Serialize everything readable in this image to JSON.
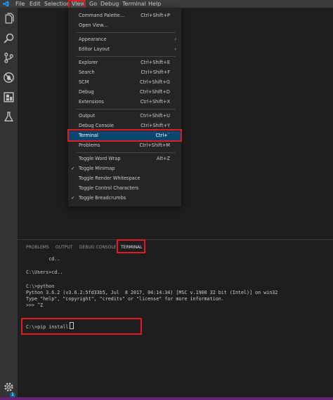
{
  "menubar": {
    "items": [
      "File",
      "Edit",
      "Selection",
      "View",
      "Go",
      "Debug",
      "Terminal",
      "Help"
    ]
  },
  "view_menu": {
    "items": [
      {
        "label": "Command Palette...",
        "shortcut": "Ctrl+Shift+P"
      },
      {
        "label": "Open View...",
        "shortcut": ""
      },
      {
        "label": "Appearance",
        "shortcut": "",
        "submenu": true
      },
      {
        "label": "Editor Layout",
        "shortcut": "",
        "submenu": true
      },
      {
        "label": "Explorer",
        "shortcut": "Ctrl+Shift+E"
      },
      {
        "label": "Search",
        "shortcut": "Ctrl+Shift+F"
      },
      {
        "label": "SCM",
        "shortcut": "Ctrl+Shift+G"
      },
      {
        "label": "Debug",
        "shortcut": "Ctrl+Shift+D"
      },
      {
        "label": "Extensions",
        "shortcut": "Ctrl+Shift+X"
      },
      {
        "label": "Output",
        "shortcut": "Ctrl+Shift+U"
      },
      {
        "label": "Debug Console",
        "shortcut": "Ctrl+Shift+Y"
      },
      {
        "label": "Terminal",
        "shortcut": "Ctrl+`",
        "selected": true
      },
      {
        "label": "Problems",
        "shortcut": "Ctrl+Shift+M"
      },
      {
        "label": "Toggle Word Wrap",
        "shortcut": "Alt+Z"
      },
      {
        "label": "Toggle Minimap",
        "shortcut": "",
        "checked": true
      },
      {
        "label": "Toggle Render Whitespace",
        "shortcut": ""
      },
      {
        "label": "Toggle Control Characters",
        "shortcut": ""
      },
      {
        "label": "Toggle Breadcrumbs",
        "shortcut": "",
        "checked": true
      }
    ],
    "check_glyph": "✓",
    "submenu_glyph": "›"
  },
  "panel": {
    "tabs": [
      "PROBLEMS",
      "OUTPUT",
      "DEBUG CONSOLE",
      "TERMINAL"
    ],
    "active_tab": "TERMINAL"
  },
  "terminal": {
    "lines": [
      "        cd..",
      "",
      "C:\\Users>cd..",
      "",
      "C:\\>python",
      "Python 3.6.2 (v3.6.2:5fd33b5, Jul  8 2017, 04:14:34) [MSC v.1900 32 bit (Intel)] on win32",
      "Type \"help\", \"copyright\", \"credits\" or \"license\" for more information.",
      ">>> ^Z"
    ],
    "prompt_line": "C:\\>pip install"
  },
  "activity_bar": {
    "icons": [
      "explorer-icon",
      "search-icon",
      "source-control-icon",
      "debug-icon",
      "extensions-icon",
      "test-flask-icon"
    ],
    "settings_badge": "1"
  },
  "colors": {
    "accent": "#094771",
    "highlight": "#e01b24",
    "status_bar": "#68217a"
  }
}
